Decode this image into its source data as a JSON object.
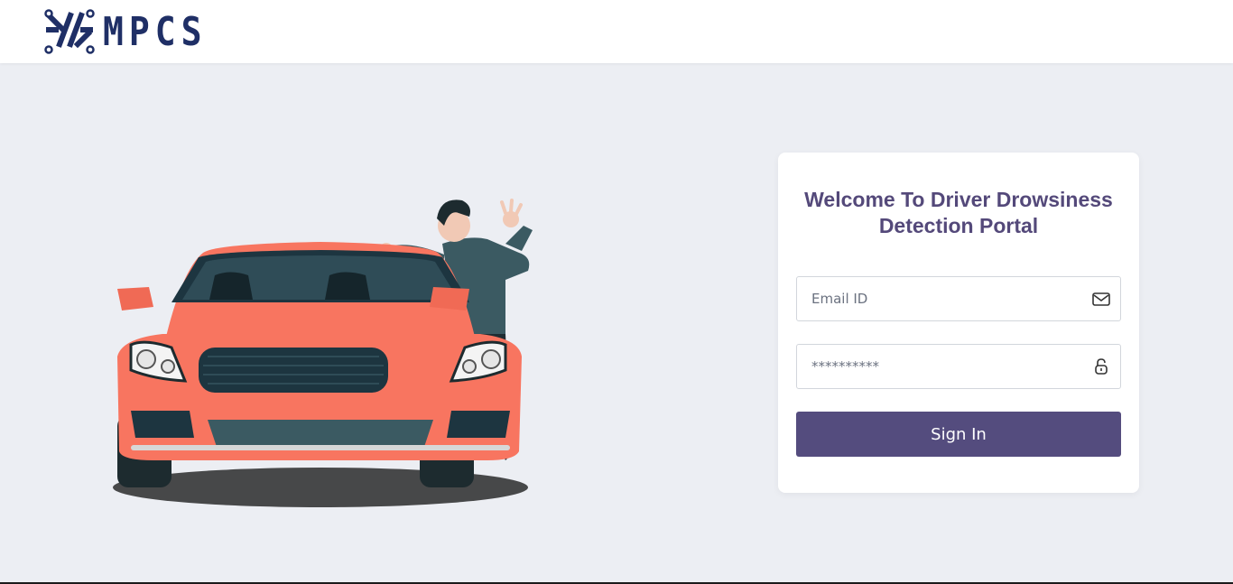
{
  "brand": {
    "name": "MPCS",
    "color": "#1f2f66"
  },
  "login": {
    "title": "Welcome To Driver Drowsiness Detection Portal",
    "email_placeholder": "Email ID",
    "password_placeholder": "**********",
    "submit_label": "Sign In",
    "icons": {
      "email": "envelope-icon",
      "password": "lock-icon"
    }
  },
  "colors": {
    "accent": "#544c7e",
    "title": "#54497a",
    "background": "#eceef3",
    "car": "#f87560"
  }
}
